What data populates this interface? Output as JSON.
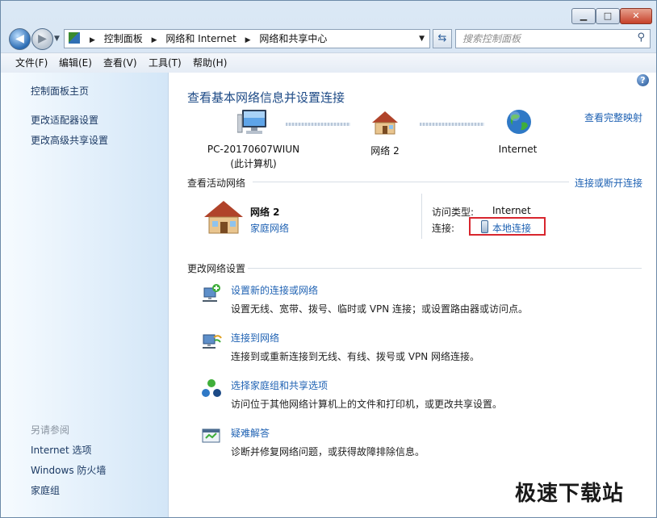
{
  "window": {
    "minimize_glyph": "▁",
    "maximize_glyph": "□",
    "close_glyph": "✕"
  },
  "address": {
    "crumbs": [
      "控制面板",
      "网络和 Internet",
      "网络和共享中心"
    ],
    "search_placeholder": "搜索控制面板"
  },
  "menu": {
    "items": [
      "文件(F)",
      "编辑(E)",
      "查看(V)",
      "工具(T)",
      "帮助(H)"
    ]
  },
  "sidebar": {
    "links": [
      "控制面板主页",
      "更改适配器设置",
      "更改高级共享设置"
    ],
    "see_also_heading": "另请参阅",
    "see_also": [
      "Internet 选项",
      "Windows 防火墙",
      "家庭组"
    ]
  },
  "main": {
    "title": "查看基本网络信息并设置连接",
    "view_full_map": "查看完整映射",
    "map": {
      "computer_name": "PC-20170607WIUN",
      "computer_sub": "(此计算机)",
      "network": "网络  2",
      "internet": "Internet"
    },
    "active_networks": {
      "title": "查看活动网络",
      "connect_disconnect": "连接或断开连接",
      "network_name": "网络  2",
      "network_type": "家庭网络",
      "access_type_label": "访问类型:",
      "access_type_value": "Internet",
      "connections_label": "连接:",
      "connections_value": "本地连接"
    },
    "change_settings": {
      "title": "更改网络设置",
      "tasks": [
        {
          "link": "设置新的连接或网络",
          "desc": "设置无线、宽带、拨号、临时或 VPN 连接；或设置路由器或访问点。"
        },
        {
          "link": "连接到网络",
          "desc": "连接到或重新连接到无线、有线、拨号或 VPN 网络连接。"
        },
        {
          "link": "选择家庭组和共享选项",
          "desc": "访问位于其他网络计算机上的文件和打印机，或更改共享设置。"
        },
        {
          "link": "疑难解答",
          "desc": "诊断并修复网络问题，或获得故障排除信息。"
        }
      ]
    }
  },
  "watermark": "极速下载站",
  "colors": {
    "link": "#1f62b3",
    "title": "#1d4a86",
    "highlight_box": "#d8262e"
  }
}
